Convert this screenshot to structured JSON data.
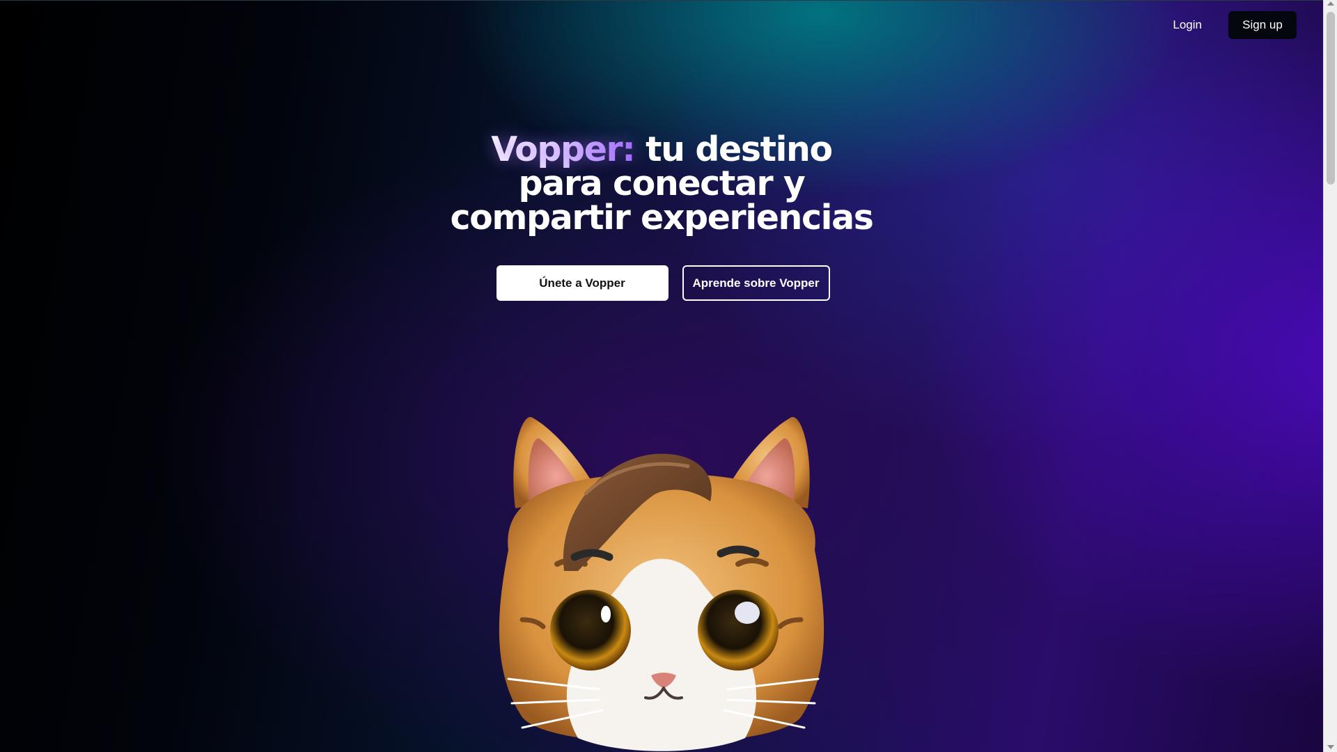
{
  "nav": {
    "login_label": "Login",
    "signup_label": "Sign up"
  },
  "hero": {
    "brand": "Vopper",
    "brand_suffix": ":",
    "line1_rest": " tu destino",
    "line2": "para conectar y",
    "line3": "compartir experiencias"
  },
  "cta": {
    "join_label": "Únete a Vopper",
    "learn_label": "Aprende sobre Vopper"
  },
  "mascot": {
    "icon": "cat-mascot-illustration"
  },
  "colors": {
    "accent_purple": "#a06bff",
    "teal_glow": "#007882",
    "deep_purple": "#4b0abe"
  }
}
